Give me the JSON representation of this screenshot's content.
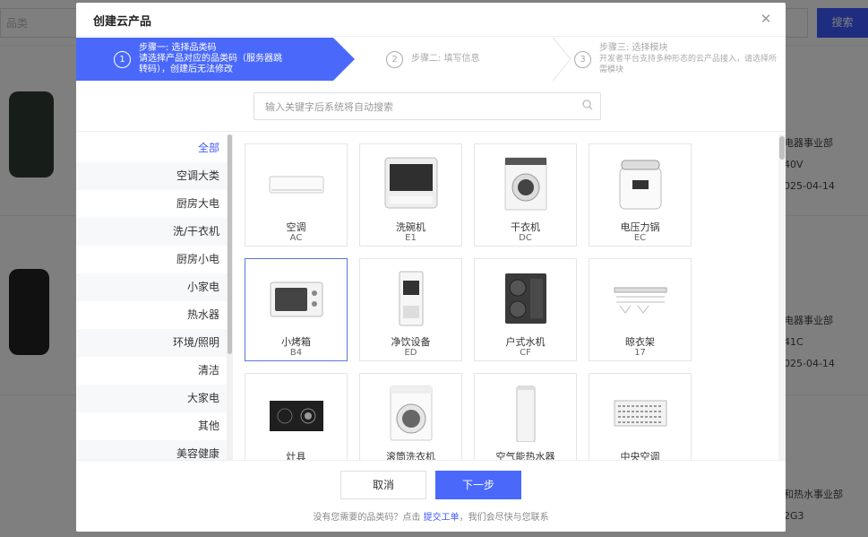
{
  "background": {
    "search_placeholder": "品类",
    "search_button": "搜索",
    "meta1": [
      "电器事业部",
      "40V",
      "025-04-14"
    ],
    "meta2": [
      "电器事业部",
      "41C",
      "025-04-14"
    ],
    "meta3": [
      "和热水事业部",
      "2G3"
    ]
  },
  "modal": {
    "title": "创建云产品",
    "steps": [
      {
        "num": "1",
        "title": "步骤一: 选择品类码",
        "desc": "请选择产品对应的品类码（服务器跳转码），创建后无法修改"
      },
      {
        "num": "2",
        "title": "步骤二: 填写信息",
        "desc": ""
      },
      {
        "num": "3",
        "title": "步骤三: 选择模块",
        "desc": "开发者平台支持多种形态的云产品接入，请选择所需模块"
      }
    ],
    "search_placeholder": "输入关键字后系统将自动搜索",
    "categories": [
      "全部",
      "空调大类",
      "厨房大电",
      "洗/干衣机",
      "厨房小电",
      "小家电",
      "热水器",
      "环境/照明",
      "清洁",
      "大家电",
      "其他",
      "美容健康"
    ],
    "active_category": "全部",
    "products": [
      {
        "name": "空调",
        "code": "AC",
        "icon": "air-conditioner-icon"
      },
      {
        "name": "洗碗机",
        "code": "E1",
        "icon": "dishwasher-icon"
      },
      {
        "name": "干衣机",
        "code": "DC",
        "icon": "dryer-icon"
      },
      {
        "name": "电压力锅",
        "code": "EC",
        "icon": "pressure-cooker-icon"
      },
      {
        "name": "小烤箱",
        "code": "B4",
        "icon": "oven-icon"
      },
      {
        "name": "净饮设备",
        "code": "ED",
        "icon": "water-dispenser-icon"
      },
      {
        "name": "户式水机",
        "code": "CF",
        "icon": "water-unit-icon"
      },
      {
        "name": "晾衣架",
        "code": "17",
        "icon": "clothes-rack-icon"
      },
      {
        "name": "灶具",
        "code": "",
        "icon": "stove-icon"
      },
      {
        "name": "滚筒洗衣机",
        "code": "",
        "icon": "washer-icon"
      },
      {
        "name": "空气能热水器",
        "code": "",
        "icon": "heat-pump-icon"
      },
      {
        "name": "中央空调",
        "code": "",
        "icon": "central-ac-icon"
      }
    ],
    "selected_product": "小烤箱",
    "cancel_label": "取消",
    "next_label": "下一步",
    "footer_prefix": "没有您需要的品类码？点击 ",
    "footer_link": "提交工单",
    "footer_suffix": "，我们会尽快与您联系"
  },
  "colors": {
    "accent": "#4a69fb",
    "selected_border": "#5b77d6"
  }
}
